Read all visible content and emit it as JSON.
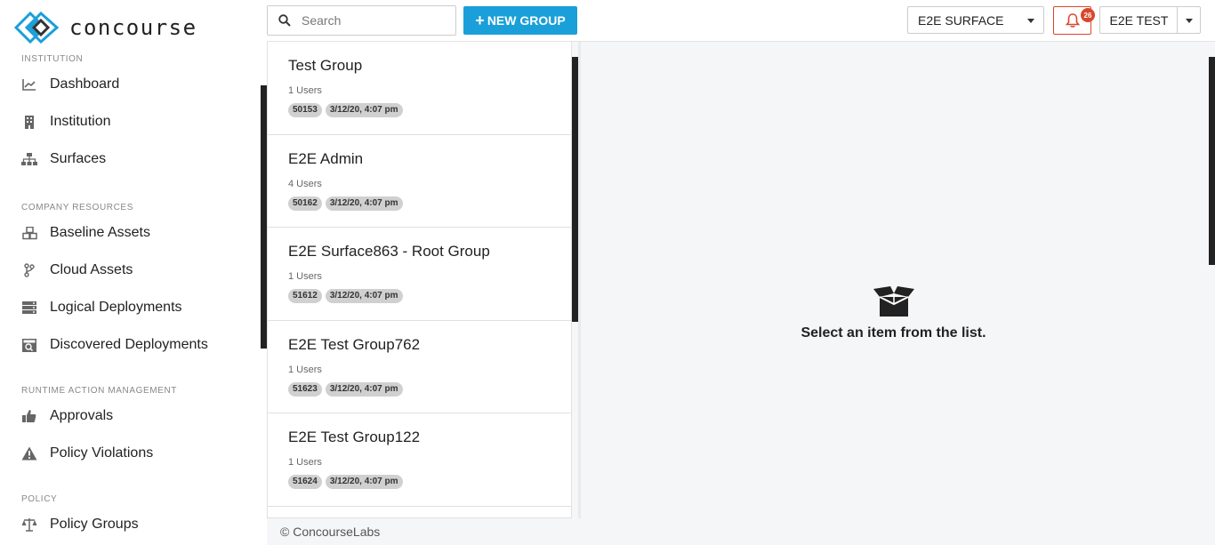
{
  "app": {
    "brand": "concourse"
  },
  "sidebar": {
    "sections": [
      {
        "title": "INSTITUTION",
        "items": [
          {
            "label": "Dashboard",
            "icon": "chart-line-icon"
          },
          {
            "label": "Institution",
            "icon": "building-icon"
          },
          {
            "label": "Surfaces",
            "icon": "sitemap-icon"
          }
        ]
      },
      {
        "title": "COMPANY RESOURCES",
        "items": [
          {
            "label": "Baseline Assets",
            "icon": "cubes-icon"
          },
          {
            "label": "Cloud Assets",
            "icon": "code-branch-icon"
          },
          {
            "label": "Logical Deployments",
            "icon": "server-icon"
          },
          {
            "label": "Discovered Deployments",
            "icon": "search-server-icon"
          }
        ]
      },
      {
        "title": "RUNTIME ACTION MANAGEMENT",
        "items": [
          {
            "label": "Approvals",
            "icon": "thumbs-up-icon"
          },
          {
            "label": "Policy Violations",
            "icon": "warning-icon"
          }
        ]
      },
      {
        "title": "POLICY",
        "items": [
          {
            "label": "Policy Groups",
            "icon": "balance-scale-icon"
          }
        ]
      }
    ]
  },
  "header": {
    "search_placeholder": "Search",
    "new_group_label": "NEW GROUP",
    "surface_selected": "E2E SURFACE",
    "notification_count": "26",
    "user_label": "E2E TEST"
  },
  "groups": [
    {
      "name": "Test Group",
      "users": "1 Users",
      "id": "50153",
      "date": "3/12/20, 4:07 pm"
    },
    {
      "name": "E2E Admin",
      "users": "4 Users",
      "id": "50162",
      "date": "3/12/20, 4:07 pm"
    },
    {
      "name": "E2E Surface863 - Root Group",
      "users": "1 Users",
      "id": "51612",
      "date": "3/12/20, 4:07 pm"
    },
    {
      "name": "E2E Test Group762",
      "users": "1 Users",
      "id": "51623",
      "date": "3/12/20, 4:07 pm"
    },
    {
      "name": "E2E Test Group122",
      "users": "1 Users",
      "id": "51624",
      "date": "3/12/20, 4:07 pm"
    }
  ],
  "empty_state": {
    "message": "Select an item from the list.",
    "icon": "open-box-icon"
  },
  "footer": {
    "text": "© ConcourseLabs"
  },
  "colors": {
    "accent": "#1a9fd9",
    "alert": "#d9472b",
    "logo_blue": "#1a9fd9"
  }
}
